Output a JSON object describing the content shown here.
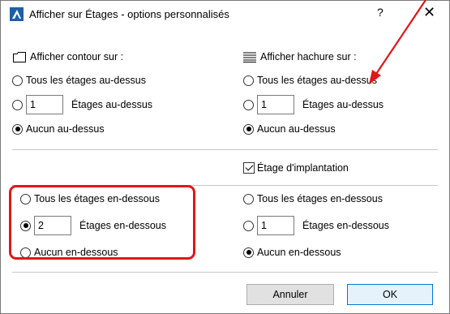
{
  "window": {
    "title": "Afficher sur Étages - options personnalisés",
    "help": "?",
    "close": "✕"
  },
  "left": {
    "header": "Afficher contour sur :",
    "above_all": "Tous les étages au-dessus",
    "above_count": "1",
    "above_count_label": "Étages au-dessus",
    "above_none": "Aucun au-dessus",
    "above_selected": "none",
    "below_all": "Tous les étages en-dessous",
    "below_count": "2",
    "below_count_label": "Étages en-dessous",
    "below_none": "Aucun en-dessous",
    "below_selected": "count"
  },
  "right": {
    "header": "Afficher hachure sur :",
    "above_all": "Tous les étages au-dessus",
    "above_count": "1",
    "above_count_label": "Étages au-dessus",
    "above_none": "Aucun au-dessus",
    "above_selected": "none",
    "home_story": "Étage d'implantation",
    "home_story_checked": true,
    "below_all": "Tous les étages en-dessous",
    "below_count": "1",
    "below_count_label": "Étages en-dessous",
    "below_none": "Aucun en-dessous",
    "below_selected": "none"
  },
  "buttons": {
    "cancel": "Annuler",
    "ok": "OK"
  },
  "colors": {
    "annotation_red": "#e01717",
    "app_icon_blue": "#1f5fa8",
    "ok_border": "#0078d7"
  },
  "icons": {
    "app": "archicad-icon",
    "contour": "contour-icon",
    "hatch": "hatch-icon"
  }
}
